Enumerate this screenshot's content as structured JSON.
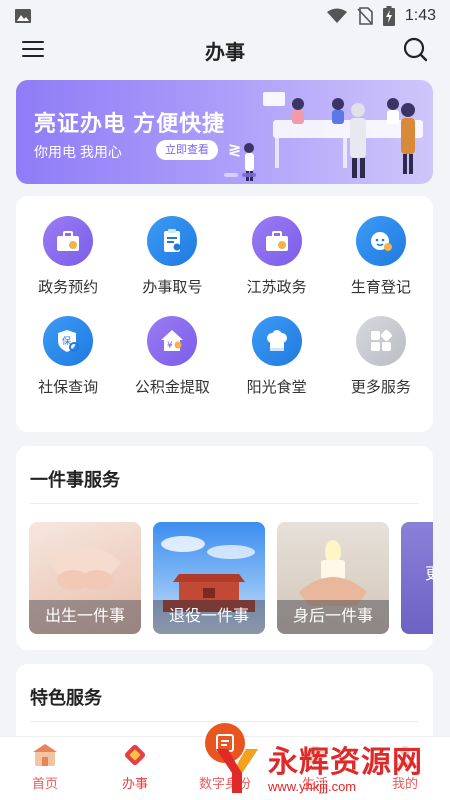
{
  "status_bar": {
    "time": "1:43"
  },
  "header": {
    "title": "办事"
  },
  "banner": {
    "headline": "亮证办电 方便快捷",
    "subline": "你用电 我用心",
    "cta": "立即查看",
    "mark": "≷"
  },
  "services": [
    {
      "label": "政务预约",
      "icon": "briefcase-icon",
      "color": "purple"
    },
    {
      "label": "办事取号",
      "icon": "clipboard-icon",
      "color": "blue"
    },
    {
      "label": "江苏政务",
      "icon": "briefcase-icon",
      "color": "purple"
    },
    {
      "label": "生育登记",
      "icon": "baby-icon",
      "color": "blue"
    },
    {
      "label": "社保查询",
      "icon": "shield-search-icon",
      "color": "blue"
    },
    {
      "label": "公积金提取",
      "icon": "house-yuan-icon",
      "color": "purple"
    },
    {
      "label": "阳光食堂",
      "icon": "chef-hat-icon",
      "color": "blue"
    },
    {
      "label": "更多服务",
      "icon": "grid-icon",
      "color": "gray"
    }
  ],
  "one_thing": {
    "title": "一件事服务",
    "items": [
      {
        "label": "出生一件事",
        "icon": "baby-feet-photo"
      },
      {
        "label": "退役一件事",
        "icon": "tiananmen-photo"
      },
      {
        "label": "身后一件事",
        "icon": "candle-photo"
      },
      {
        "label": "更",
        "icon": "lavender-photo"
      }
    ]
  },
  "features": {
    "title": "特色服务"
  },
  "tabs": [
    {
      "label": "首页",
      "icon": "home-icon"
    },
    {
      "label": "办事",
      "icon": "diamond-icon",
      "active": true
    },
    {
      "label": "数字身份",
      "icon": "id-icon"
    },
    {
      "label": "生活",
      "icon": "life-icon"
    },
    {
      "label": "我的",
      "icon": "user-icon"
    }
  ],
  "watermark": {
    "title": "永辉资源网",
    "url": "www.yhkjjj.com"
  },
  "colors": {
    "accent_purple": "#8f7cf7",
    "accent_blue": "#1f7ae0",
    "tab_active": "#e64040",
    "watermark_red": "#e02a2a"
  }
}
